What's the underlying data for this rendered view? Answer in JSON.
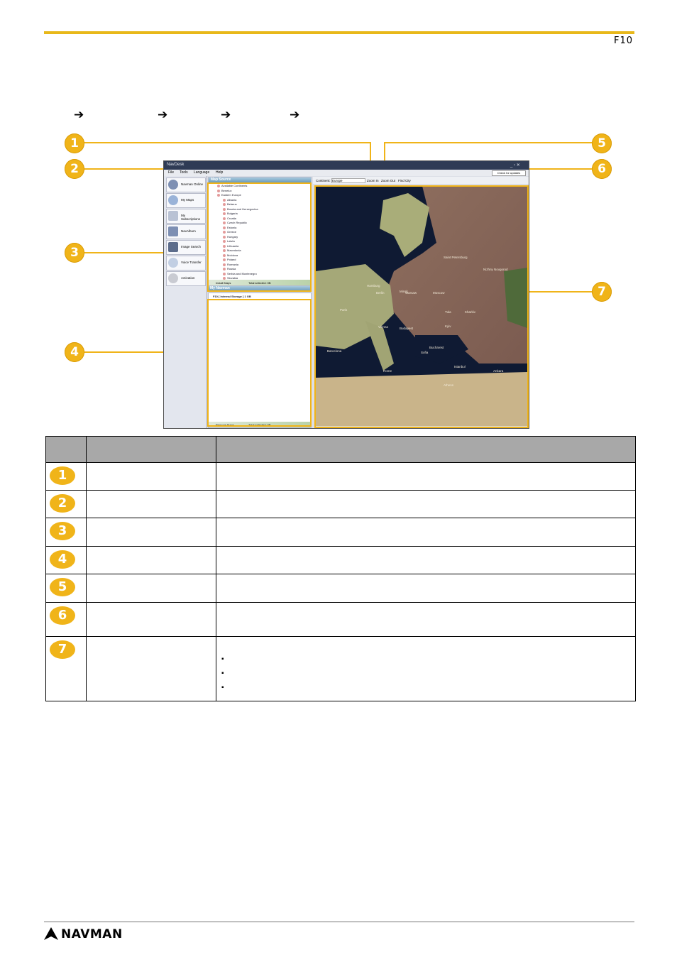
{
  "header": {
    "model": "F10"
  },
  "breadcrumb_arrows": [
    "➔",
    "➔",
    "➔",
    "➔"
  ],
  "callouts": [
    "1",
    "2",
    "3",
    "4",
    "5",
    "6",
    "7"
  ],
  "colors": {
    "accent": "#f0b419",
    "rule": "#e8b81a",
    "table_header": "#a8a8a8"
  },
  "screenshot": {
    "title": "NavDesk",
    "window_buttons": "_ ▫ ✕",
    "menu": [
      "File",
      "Tools",
      "Language",
      "Help"
    ],
    "check_updates": "Check for updates",
    "nav": [
      "Navman Online",
      "My Maps",
      "My Subscriptions",
      "NavAlbum",
      "Image Search",
      "Voice Transfer",
      "Activation"
    ],
    "map_source": {
      "title": "Map Source",
      "tree": [
        "Available Continents",
        "Benelux",
        "Eastern Europe",
        "Albania",
        "Belarus",
        "Bosnia and Herzegovina",
        "Bulgaria",
        "Croatia",
        "Czech Republic",
        "Estonia",
        "Greece",
        "Hungary",
        "Latvia",
        "Lithuania",
        "Macedonia",
        "Moldova",
        "Poland",
        "Romania",
        "Russia",
        "Serbia and Montenegro",
        "Slovakia"
      ],
      "install_button": "Install Maps",
      "total_selected": "Total selected: 0B"
    },
    "my_navman": {
      "title": "My Navman",
      "device": "F10 [ Internal Storage ] 1 GB",
      "remove_button": "Remove Maps",
      "total_selected": "Total selected: 0B"
    },
    "toolbar": {
      "continent_label": "Continent:",
      "continent_value": "Europe",
      "zoom_in": "Zoom In",
      "zoom_out": "Zoom Out",
      "find_city": "Find City"
    },
    "map_labels": [
      "Saint Petersburg",
      "Nizhny Novgorod",
      "Moscow",
      "Minsk",
      "Tula",
      "Kyiv",
      "Kharkiv",
      "Berlin",
      "Hamburg",
      "Paris",
      "Warsaw",
      "Vienna",
      "Budapest",
      "Bucharest",
      "Barcelona",
      "Istanbul",
      "Sofia",
      "Athens",
      "Rome",
      "Ankara"
    ]
  },
  "table_rows": [
    {
      "num": "1",
      "bullets": []
    },
    {
      "num": "2",
      "bullets": []
    },
    {
      "num": "3",
      "bullets": []
    },
    {
      "num": "4",
      "bullets": []
    },
    {
      "num": "5",
      "bullets": []
    },
    {
      "num": "6",
      "bullets": []
    },
    {
      "num": "7",
      "bullets": [
        "▪",
        "▪",
        "▪"
      ]
    }
  ],
  "footer": {
    "brand": "NAVMAN"
  }
}
